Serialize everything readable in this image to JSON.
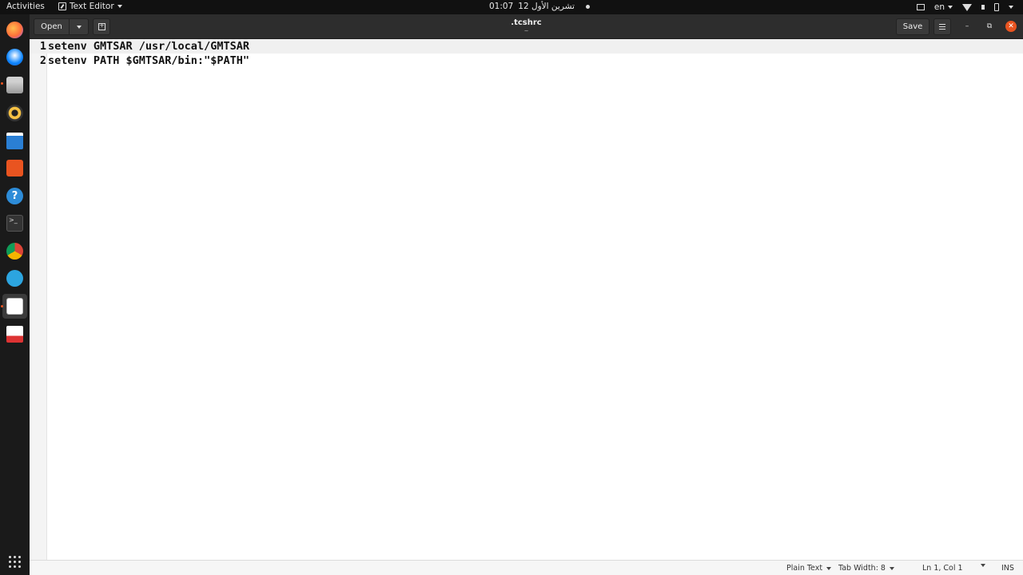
{
  "topbar": {
    "activities": "Activities",
    "app_name": "Text Editor",
    "clock_date": "تشرين الأول 12",
    "clock_time": "01:07",
    "keyboard_layout": "en"
  },
  "dock": {
    "items": [
      "firefox",
      "thunderbird",
      "files",
      "rhythmbox",
      "libreoffice-writer",
      "ubuntu-software",
      "help",
      "terminal",
      "chrome",
      "telegram",
      "text-editor",
      "document-viewer"
    ],
    "show_apps": "show-applications-icon"
  },
  "window": {
    "open_label": "Open",
    "save_label": "Save",
    "title": ".tcshrc",
    "subtitle": "~"
  },
  "editor": {
    "lines": [
      {
        "number": "1",
        "text": "setenv GMTSAR /usr/local/GMTSAR"
      },
      {
        "number": "2",
        "text": "setenv PATH $GMTSAR/bin:\"$PATH\""
      }
    ]
  },
  "statusbar": {
    "language": "Plain Text",
    "tab_width": "Tab Width: 8",
    "position": "Ln 1, Col 1",
    "mode": "INS"
  },
  "colors": {
    "accent": "#e95420",
    "headerbar": "#2d2d2d",
    "topbar": "#111111"
  }
}
